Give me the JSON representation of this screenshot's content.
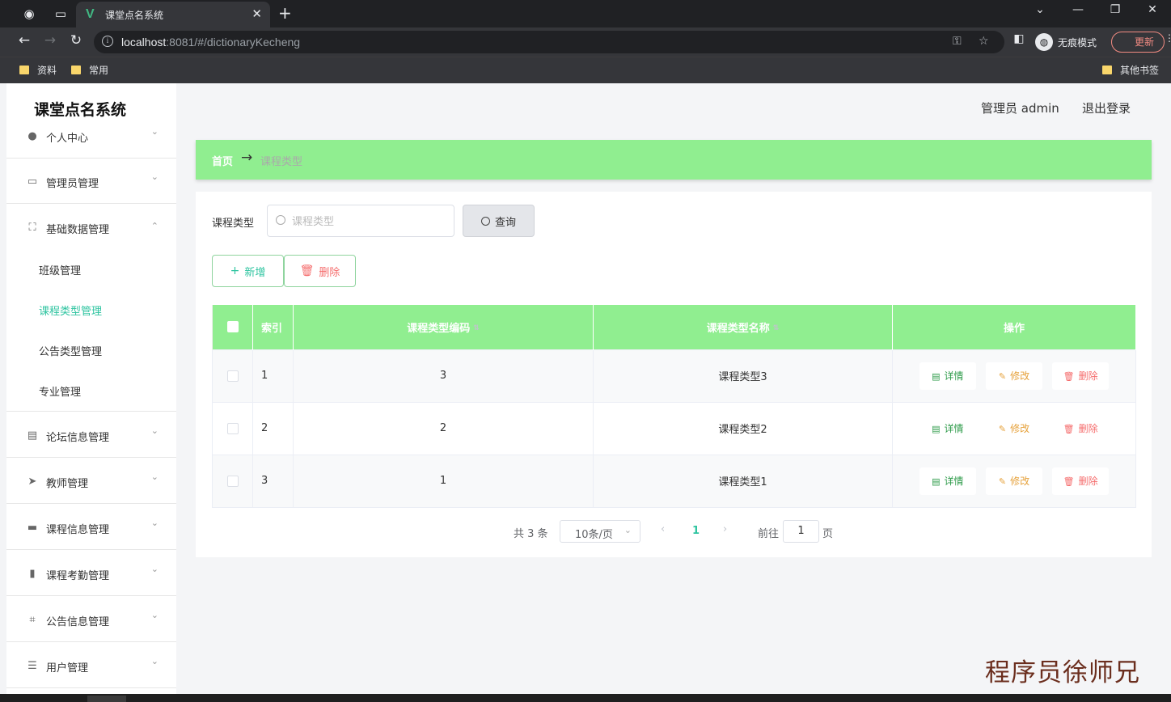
{
  "browser": {
    "tab_title": "课堂点名系统",
    "url_host": "localhost",
    "url_rest": ":8081/#/dictionaryKecheng",
    "incognito_label": "无痕模式",
    "update_label": "更新",
    "bookmarks": [
      "资料",
      "常用"
    ],
    "other_bookmarks": "其他书签"
  },
  "app": {
    "brand": "课堂点名系统",
    "user_label": "管理员 admin",
    "logout_label": "退出登录"
  },
  "sidebar": {
    "items": [
      {
        "label": "个人中心",
        "icon": "user-icon",
        "arrow": "⌄"
      },
      {
        "label": "管理员管理",
        "icon": "id-card-icon",
        "arrow": "⌄"
      },
      {
        "label": "基础数据管理",
        "icon": "frame-icon",
        "arrow": "⌃"
      },
      {
        "label": "论坛信息管理",
        "icon": "chat-icon",
        "arrow": "⌄"
      },
      {
        "label": "教师管理",
        "icon": "send-icon",
        "arrow": "⌄"
      },
      {
        "label": "课程信息管理",
        "icon": "briefcase-icon",
        "arrow": "⌄"
      },
      {
        "label": "课程考勤管理",
        "icon": "clipboard-icon",
        "arrow": "⌄"
      },
      {
        "label": "公告信息管理",
        "icon": "crop-icon",
        "arrow": "⌄"
      },
      {
        "label": "用户管理",
        "icon": "list-icon",
        "arrow": "⌄"
      }
    ],
    "sub_items": [
      "班级管理",
      "课程类型管理",
      "公告类型管理",
      "专业管理"
    ]
  },
  "breadcrumb": {
    "home": "首页",
    "arrow": "→",
    "current": "课程类型"
  },
  "search": {
    "label": "课程类型",
    "placeholder": "课程类型",
    "query_label": "查询"
  },
  "actions": {
    "add_label": "新增",
    "delete_label": "删除"
  },
  "table": {
    "headers": [
      "索引",
      "课程类型编码",
      "课程类型名称",
      "操作"
    ],
    "rows": [
      {
        "index": "1",
        "code": "3",
        "name": "课程类型3"
      },
      {
        "index": "2",
        "code": "2",
        "name": "课程类型2"
      },
      {
        "index": "3",
        "code": "1",
        "name": "课程类型1"
      }
    ],
    "op_detail": "详情",
    "op_edit": "修改",
    "op_delete": "删除"
  },
  "pagination": {
    "total": "共 3 条",
    "page_size": "10条/页",
    "current_page": "1",
    "goto_label": "前往",
    "goto_value": "1",
    "page_suffix": "页"
  },
  "watermark": "程序员徐师兄",
  "colors": {
    "accent_green": "#90ee90",
    "active_text": "#2ec4a0",
    "danger": "#f56c6c",
    "warning": "#e6a23c"
  }
}
